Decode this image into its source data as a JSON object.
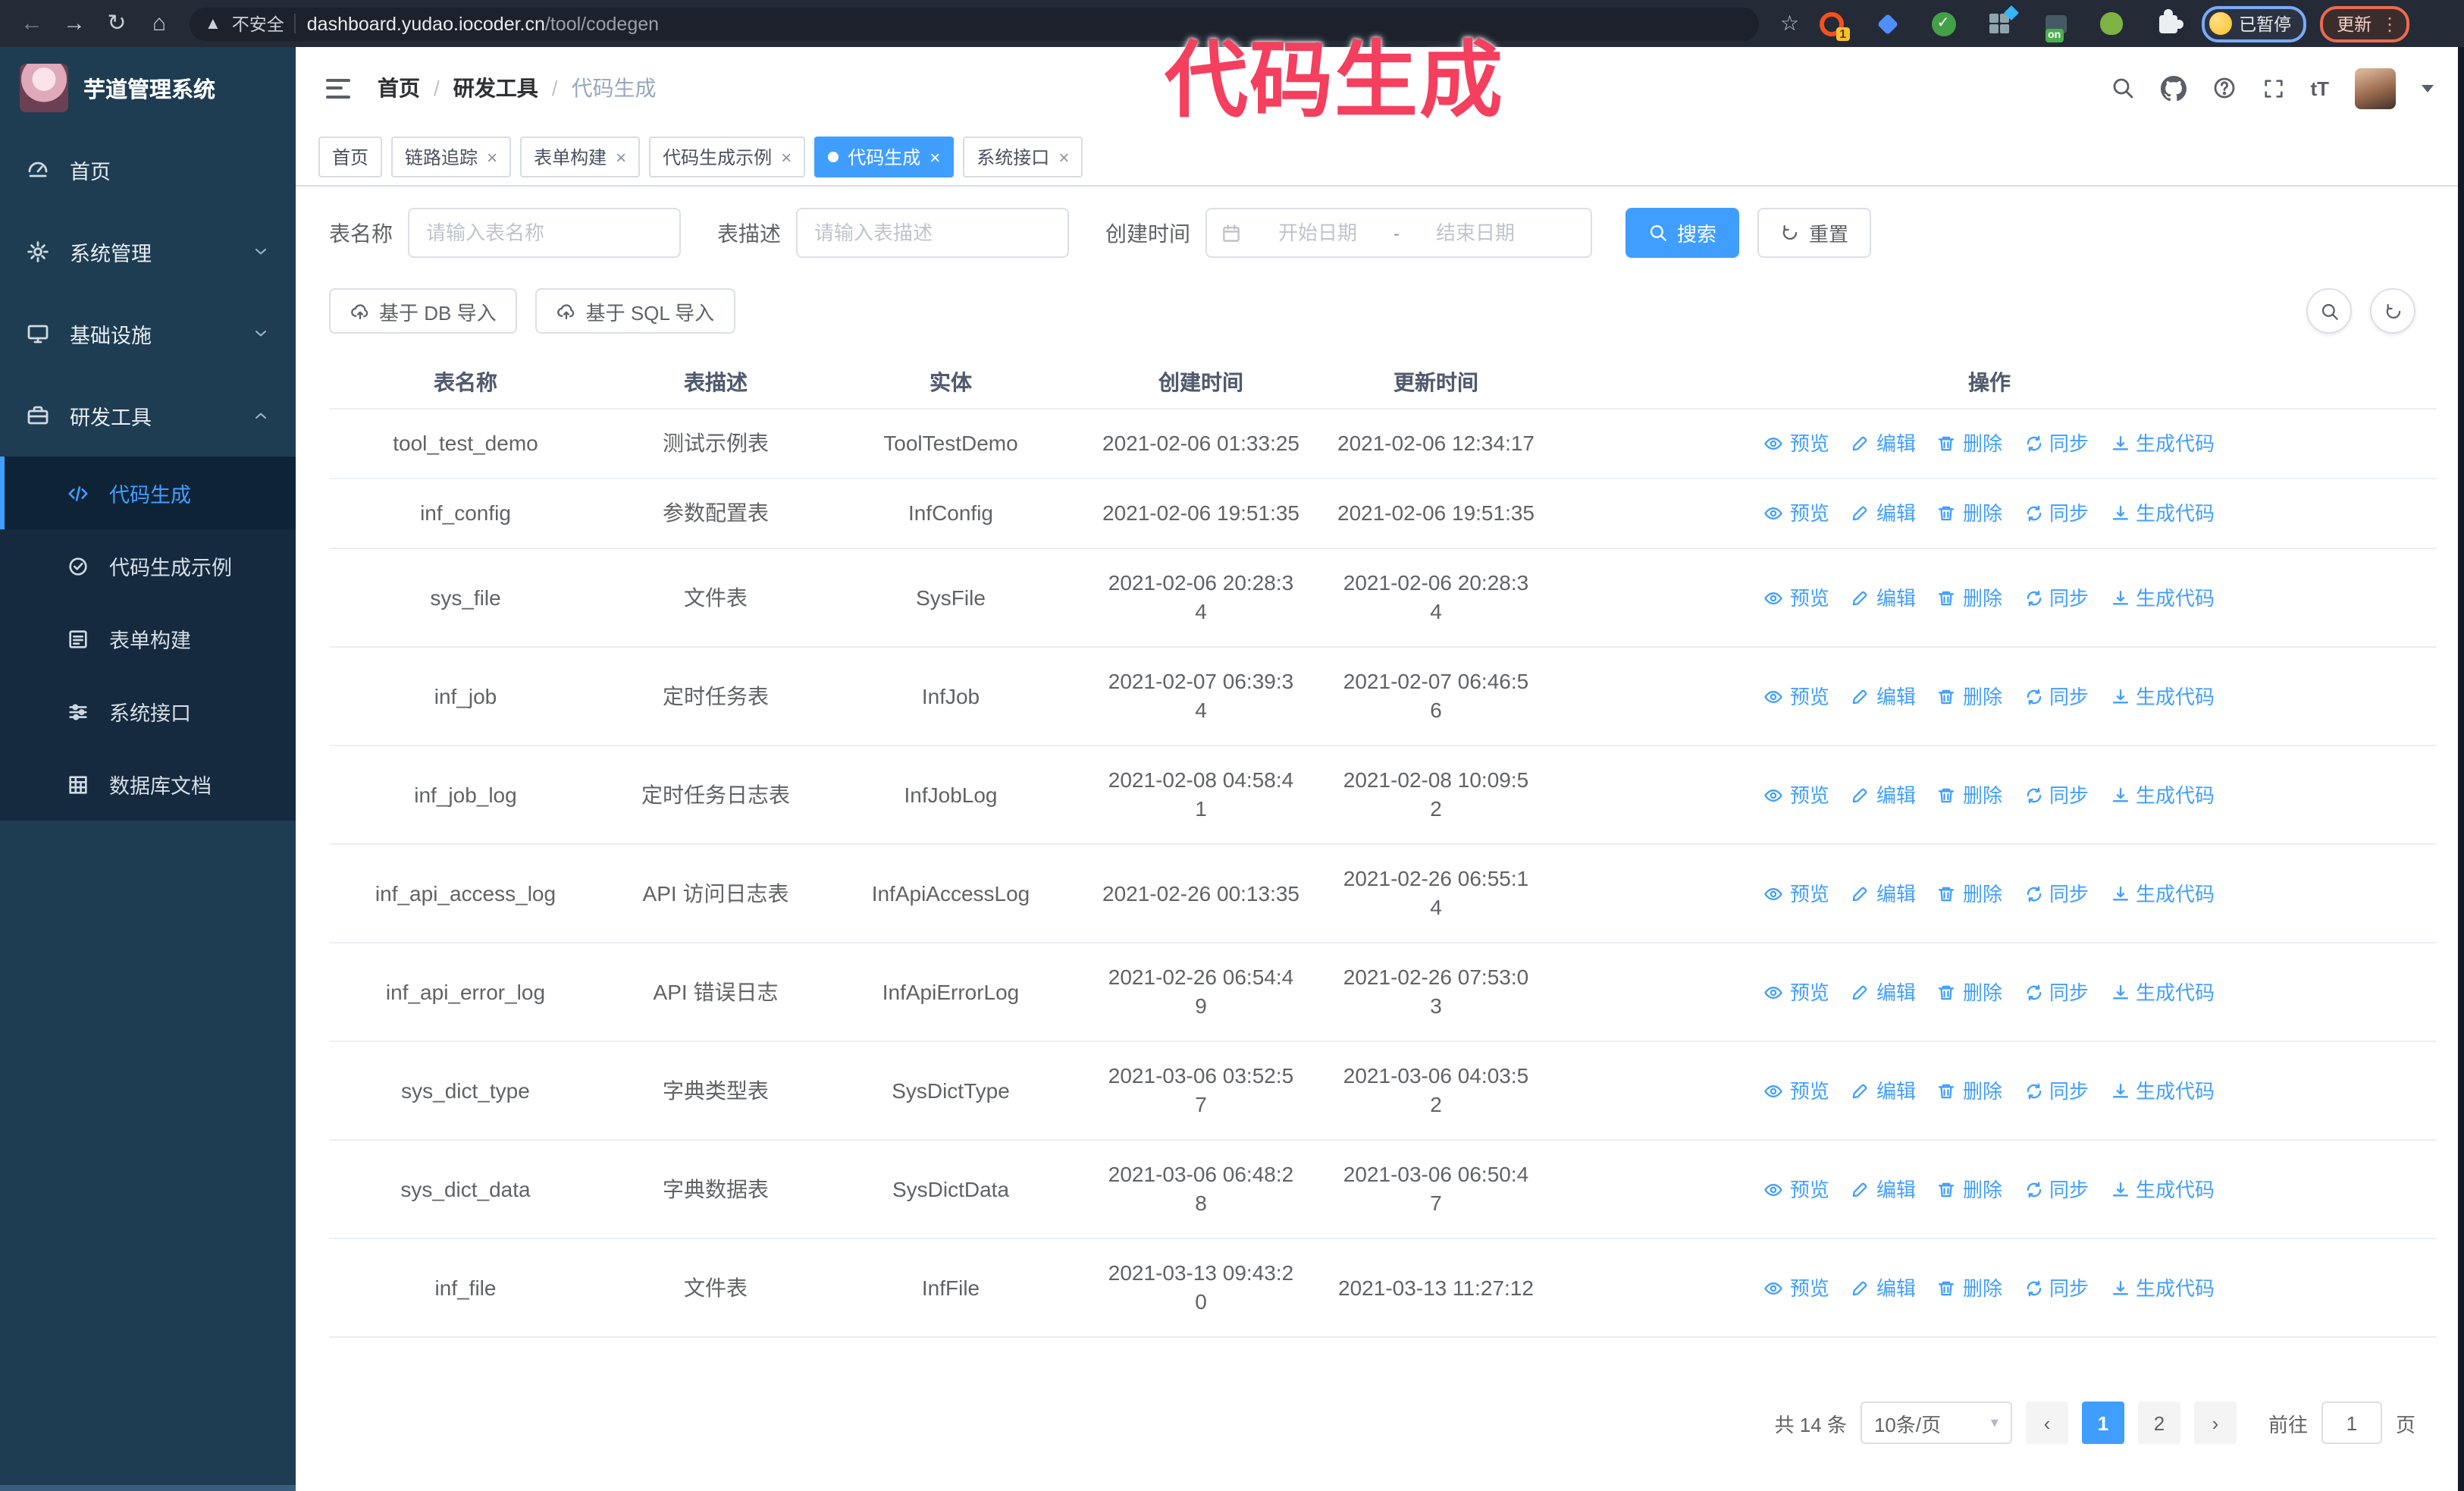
{
  "browser": {
    "security_label": "不安全",
    "url_host": "dashboard.yudao.iocoder.cn",
    "url_path": "/tool/codegen",
    "extension_badge": "1",
    "extension_on_badge": "on",
    "paused_chip_label": "已暂停",
    "update_chip_label": "更新"
  },
  "overlay_title": "代码生成",
  "sidebar": {
    "app_title": "芋道管理系统",
    "items": [
      {
        "label": "首页"
      },
      {
        "label": "系统管理"
      },
      {
        "label": "基础设施"
      },
      {
        "label": "研发工具"
      }
    ],
    "sub_items": [
      {
        "label": "代码生成"
      },
      {
        "label": "代码生成示例"
      },
      {
        "label": "表单构建"
      },
      {
        "label": "系统接口"
      },
      {
        "label": "数据库文档"
      }
    ]
  },
  "breadcrumb": {
    "items": [
      "首页",
      "研发工具",
      "代码生成"
    ]
  },
  "tabs": [
    {
      "label": "首页"
    },
    {
      "label": "链路追踪"
    },
    {
      "label": "表单构建"
    },
    {
      "label": "代码生成示例"
    },
    {
      "label": "代码生成"
    },
    {
      "label": "系统接口"
    }
  ],
  "filters": {
    "table_name_label": "表名称",
    "table_name_placeholder": "请输入表名称",
    "table_desc_label": "表描述",
    "table_desc_placeholder": "请输入表描述",
    "create_time_label": "创建时间",
    "start_date_placeholder": "开始日期",
    "range_separator": "-",
    "end_date_placeholder": "结束日期",
    "search_label": "搜索",
    "reset_label": "重置"
  },
  "toolbar": {
    "import_db_label": "基于 DB 导入",
    "import_sql_label": "基于 SQL 导入"
  },
  "table": {
    "columns": [
      "表名称",
      "表描述",
      "实体",
      "创建时间",
      "更新时间",
      "操作"
    ],
    "action_labels": [
      "预览",
      "编辑",
      "删除",
      "同步",
      "生成代码"
    ],
    "rows": [
      {
        "name": "tool_test_demo",
        "desc": "测试示例表",
        "entity": "ToolTestDemo",
        "created": "2021-02-06 01:33:25",
        "updated": "2021-02-06 12:34:17"
      },
      {
        "name": "inf_config",
        "desc": "参数配置表",
        "entity": "InfConfig",
        "created": "2021-02-06 19:51:35",
        "updated": "2021-02-06 19:51:35"
      },
      {
        "name": "sys_file",
        "desc": "文件表",
        "entity": "SysFile",
        "created": "2021-02-06 20:28:3\n4",
        "updated": "2021-02-06 20:28:3\n4"
      },
      {
        "name": "inf_job",
        "desc": "定时任务表",
        "entity": "InfJob",
        "created": "2021-02-07 06:39:3\n4",
        "updated": "2021-02-07 06:46:5\n6"
      },
      {
        "name": "inf_job_log",
        "desc": "定时任务日志表",
        "entity": "InfJobLog",
        "created": "2021-02-08 04:58:4\n1",
        "updated": "2021-02-08 10:09:5\n2"
      },
      {
        "name": "inf_api_access_log",
        "desc": "API 访问日志表",
        "entity": "InfApiAccessLog",
        "created": "2021-02-26 00:13:35",
        "updated": "2021-02-26 06:55:1\n4"
      },
      {
        "name": "inf_api_error_log",
        "desc": "API 错误日志",
        "entity": "InfApiErrorLog",
        "created": "2021-02-26 06:54:4\n9",
        "updated": "2021-02-26 07:53:0\n3"
      },
      {
        "name": "sys_dict_type",
        "desc": "字典类型表",
        "entity": "SysDictType",
        "created": "2021-03-06 03:52:5\n7",
        "updated": "2021-03-06 04:03:5\n2"
      },
      {
        "name": "sys_dict_data",
        "desc": "字典数据表",
        "entity": "SysDictData",
        "created": "2021-03-06 06:48:2\n8",
        "updated": "2021-03-06 06:50:4\n7"
      },
      {
        "name": "inf_file",
        "desc": "文件表",
        "entity": "InfFile",
        "created": "2021-03-13 09:43:2\n0",
        "updated": "2021-03-13 11:27:12"
      }
    ]
  },
  "pagination": {
    "total_label": "共 14 条",
    "page_size_label": "10条/页",
    "pages": [
      "1",
      "2"
    ],
    "active_page": "1",
    "goto_label": "前往",
    "goto_value": "1",
    "page_suffix_label": "页"
  },
  "colors": {
    "accent": "#409eff",
    "overlay_title": "#f43f5f",
    "sidebar_bg": "#1e3c52",
    "submenu_bg": "#152a3f"
  }
}
